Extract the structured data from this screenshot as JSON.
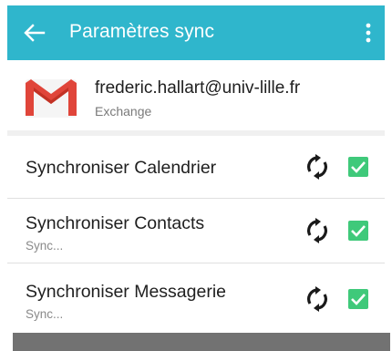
{
  "appbar": {
    "title": "Paramètres sync",
    "background": "#2fb6cc",
    "back_icon": "arrow-left-icon",
    "menu_icon": "more-vert-icon"
  },
  "account": {
    "email": "frederic.hallart@univ-lille.fr",
    "type": "Exchange",
    "icon": "gmail-icon"
  },
  "sync_items": [
    {
      "label": "Synchroniser Calendrier",
      "status": "",
      "checked": true
    },
    {
      "label": "Synchroniser Contacts",
      "status": "Sync...",
      "checked": true
    },
    {
      "label": "Synchroniser Messagerie",
      "status": "Sync...",
      "checked": true
    }
  ],
  "colors": {
    "accent": "#2fb6cc",
    "checkbox": "#3fc97a"
  }
}
